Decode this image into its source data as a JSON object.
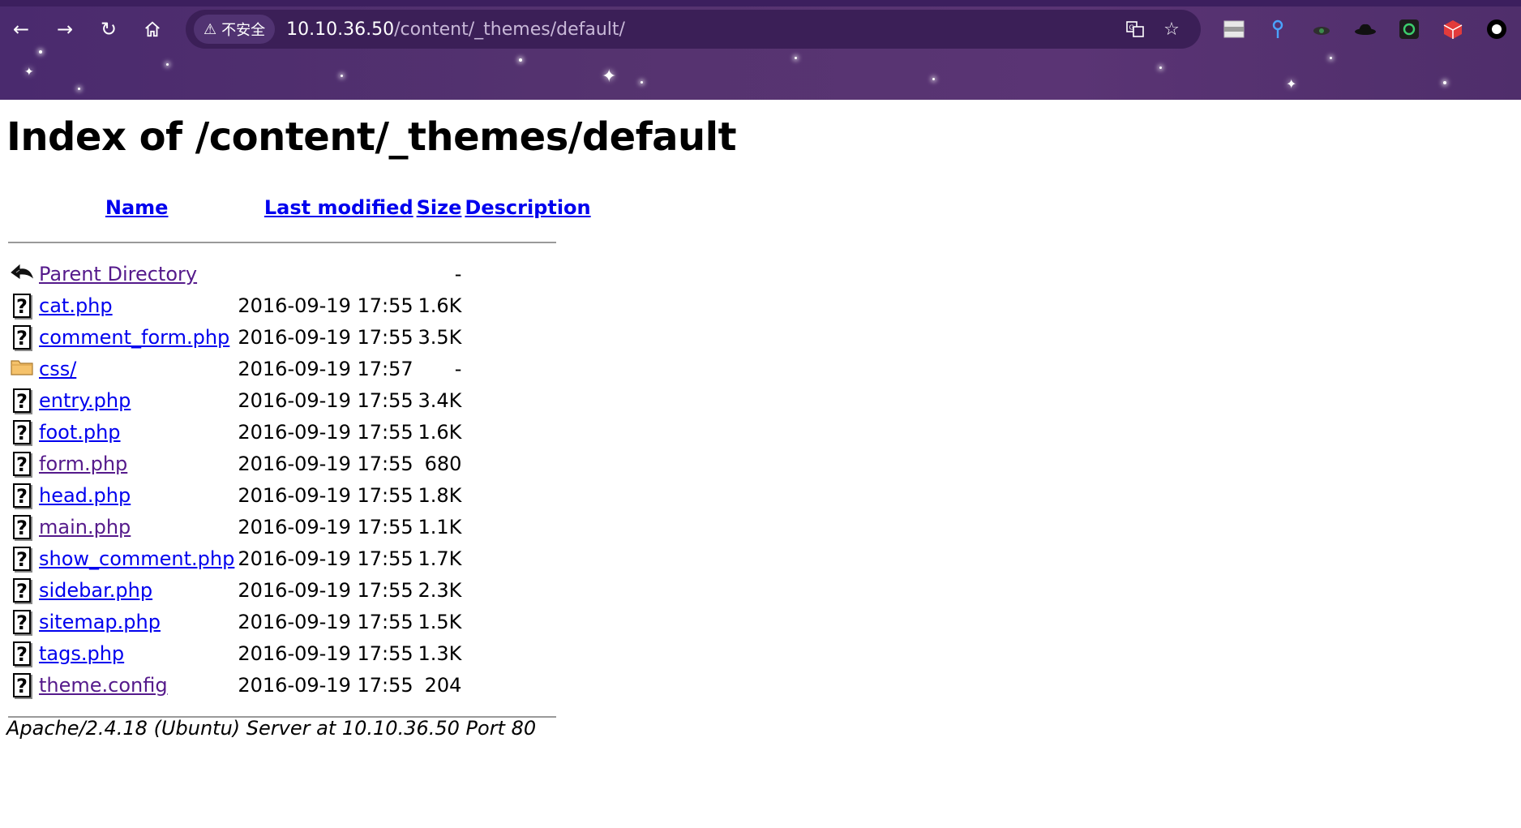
{
  "browser": {
    "security_label": "不安全",
    "url_host": "10.10.36.50",
    "url_path": "/content/_themes/default/"
  },
  "page": {
    "title": "Index of /content/_themes/default",
    "columns": {
      "name": "Name",
      "last_modified": "Last modified",
      "size": "Size",
      "description": "Description"
    },
    "parent": {
      "label": "Parent Directory",
      "size": "-"
    },
    "entries": [
      {
        "name": "cat.php",
        "modified": "2016-09-19 17:55",
        "size": "1.6K",
        "icon": "unknown-file-icon",
        "visited": false
      },
      {
        "name": "comment_form.php",
        "modified": "2016-09-19 17:55",
        "size": "3.5K",
        "icon": "unknown-file-icon",
        "visited": false
      },
      {
        "name": "css/",
        "modified": "2016-09-19 17:57",
        "size": "-",
        "icon": "folder-icon",
        "visited": false
      },
      {
        "name": "entry.php",
        "modified": "2016-09-19 17:55",
        "size": "3.4K",
        "icon": "unknown-file-icon",
        "visited": false
      },
      {
        "name": "foot.php",
        "modified": "2016-09-19 17:55",
        "size": "1.6K",
        "icon": "unknown-file-icon",
        "visited": false
      },
      {
        "name": "form.php",
        "modified": "2016-09-19 17:55",
        "size": "680",
        "icon": "unknown-file-icon",
        "visited": true
      },
      {
        "name": "head.php",
        "modified": "2016-09-19 17:55",
        "size": "1.8K",
        "icon": "unknown-file-icon",
        "visited": false
      },
      {
        "name": "main.php",
        "modified": "2016-09-19 17:55",
        "size": "1.1K",
        "icon": "unknown-file-icon",
        "visited": true
      },
      {
        "name": "show_comment.php",
        "modified": "2016-09-19 17:55",
        "size": "1.7K",
        "icon": "unknown-file-icon",
        "visited": false
      },
      {
        "name": "sidebar.php",
        "modified": "2016-09-19 17:55",
        "size": "2.3K",
        "icon": "unknown-file-icon",
        "visited": false
      },
      {
        "name": "sitemap.php",
        "modified": "2016-09-19 17:55",
        "size": "1.5K",
        "icon": "unknown-file-icon",
        "visited": false
      },
      {
        "name": "tags.php",
        "modified": "2016-09-19 17:55",
        "size": "1.3K",
        "icon": "unknown-file-icon",
        "visited": false
      },
      {
        "name": "theme.config",
        "modified": "2016-09-19 17:55",
        "size": "204",
        "icon": "unknown-file-icon",
        "visited": true
      }
    ],
    "footer": "Apache/2.4.18 (Ubuntu) Server at 10.10.36.50 Port 80"
  },
  "colors": {
    "link": "#0000ee",
    "visited": "#551a8b",
    "chrome": "#55336f"
  }
}
